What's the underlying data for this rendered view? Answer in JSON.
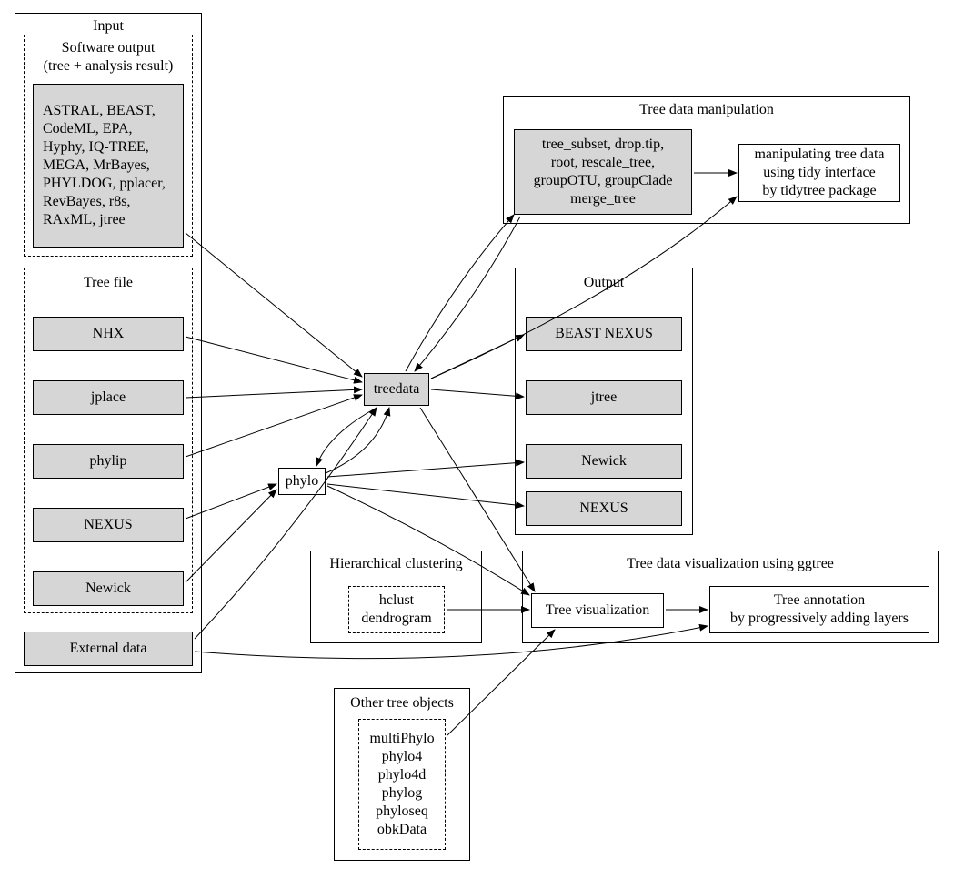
{
  "input_panel": {
    "title": "Input",
    "software_output": {
      "title": "Software output\n(tree + analysis result)",
      "content": "ASTRAL, BEAST,\nCodeML, EPA,\nHyphy, IQ-TREE,\nMEGA, MrBayes,\nPHYLDOG, pplacer,\nRevBayes, r8s,\nRAxML, jtree"
    },
    "tree_file": {
      "title": "Tree file",
      "items": [
        "NHX",
        "jplace",
        "phylip",
        "NEXUS",
        "Newick"
      ]
    },
    "external_data": "External data"
  },
  "center": {
    "treedata": "treedata",
    "phylo": "phylo"
  },
  "manipulation_panel": {
    "title": "Tree data manipulation",
    "functions": "tree_subset, drop.tip,\nroot, rescale_tree,\ngroupOTU, groupClade\nmerge_tree",
    "tidy": "manipulating tree data\nusing tidy interface\nby tidytree package"
  },
  "output_panel": {
    "title": "Output",
    "items": [
      "BEAST NEXUS",
      "jtree",
      "Newick",
      "NEXUS"
    ]
  },
  "hclust_panel": {
    "title": "Hierarchical clustering",
    "content": "hclust\ndendrogram"
  },
  "viz_panel": {
    "title": "Tree data visualization using ggtree",
    "treeviz": "Tree visualization",
    "annotation": "Tree annotation\nby progressively adding layers"
  },
  "other_objects_panel": {
    "title": "Other tree objects",
    "content": "multiPhylo\nphylo4\nphylo4d\nphylog\nphyloseq\nobkData"
  }
}
